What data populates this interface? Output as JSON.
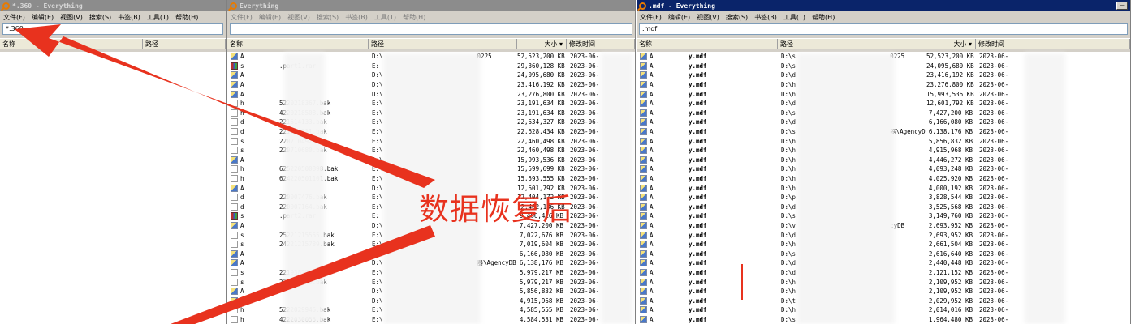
{
  "windows": [
    {
      "title": "*.360 - Everything",
      "menu": [
        "文件(F)",
        "编辑(E)",
        "视图(V)",
        "搜索(S)",
        "书签(B)",
        "工具(T)",
        "帮助(H)"
      ],
      "search": "*.360",
      "columns": [
        "名称",
        "路径"
      ]
    },
    {
      "title": "Everything",
      "menu": [
        "文件(F)",
        "编辑(E)",
        "视图(V)",
        "搜索(S)",
        "书签(B)",
        "工具(T)",
        "帮助(H)"
      ],
      "search": "",
      "columns": [
        "名称",
        "路径",
        "大小",
        "修改时间"
      ],
      "rows": [
        {
          "icon": "db",
          "pre": "A",
          "suf": "",
          "path": "D:\\",
          "path_end": "0225",
          "size": "52,523,200 KB",
          "date": "2023-06-"
        },
        {
          "icon": "rar",
          "pre": "s",
          "suf": ".part1.rar",
          "path": "E:",
          "path_end": "",
          "size": "29,360,128 KB",
          "date": "2023-06-"
        },
        {
          "icon": "db",
          "pre": "A",
          "suf": "",
          "path": "D:\\",
          "path_end": "",
          "size": "24,095,680 KB",
          "date": "2023-06-"
        },
        {
          "icon": "db",
          "pre": "A",
          "suf": "",
          "path": "D:\\",
          "path_end": "",
          "size": "23,416,192 KB",
          "date": "2023-06-"
        },
        {
          "icon": "db",
          "pre": "A",
          "suf": "",
          "path": "D:\\",
          "path_end": "",
          "size": "23,276,800 KB",
          "date": "2023-06-"
        },
        {
          "icon": "doc",
          "pre": "h",
          "suf": "5220218367.bak",
          "path": "E:\\",
          "path_end": "",
          "size": "23,191,634 KB",
          "date": "2023-06-"
        },
        {
          "icon": "doc",
          "pre": "h",
          "suf": "4220218508.bak",
          "path": "E:\\",
          "path_end": "",
          "size": "23,191,634 KB",
          "date": "2023-06-"
        },
        {
          "icon": "doc",
          "pre": "d",
          "suf": "221514133.bak",
          "path": "E:\\",
          "path_end": "",
          "size": "22,634,327 KB",
          "date": "2023-06-"
        },
        {
          "icon": "doc",
          "pre": "d",
          "suf": "221514211.bak",
          "path": "E:\\",
          "path_end": "",
          "size": "22,628,434 KB",
          "date": "2023-06-"
        },
        {
          "icon": "doc",
          "pre": "s",
          "suf": "220710492.bak",
          "path": "E:\\",
          "path_end": "",
          "size": "22,460,498 KB",
          "date": "2023-06-"
        },
        {
          "icon": "doc",
          "pre": "s",
          "suf": "220710680.bak",
          "path": "E:\\",
          "path_end": "",
          "size": "22,460,498 KB",
          "date": "2023-06-"
        },
        {
          "icon": "db",
          "pre": "A",
          "suf": "",
          "path": "D:\\",
          "path_end": "",
          "size": "15,993,536 KB",
          "date": "2023-06-"
        },
        {
          "icon": "doc",
          "pre": "h",
          "suf": "625220500898.bak",
          "path": "E:\\",
          "path_end": "",
          "size": "15,599,699 KB",
          "date": "2023-06-"
        },
        {
          "icon": "doc",
          "pre": "h",
          "suf": "624220501101.bak",
          "path": "E:\\",
          "path_end": "",
          "size": "15,593,555 KB",
          "date": "2023-06-"
        },
        {
          "icon": "db",
          "pre": "A",
          "suf": "",
          "path": "D:\\",
          "path_end": "",
          "size": "12,601,792 KB",
          "date": "2023-06-"
        },
        {
          "icon": "doc",
          "pre": "d",
          "suf": "220007476.bak",
          "path": "E:\\",
          "path_end": "",
          "size": "12,404,172 KB",
          "date": "2023-06-"
        },
        {
          "icon": "doc",
          "pre": "d",
          "suf": "220007164.bak",
          "path": "E:\\",
          "path_end": "",
          "size": "12,402,136 KB",
          "date": "2023-06-"
        },
        {
          "icon": "rar",
          "pre": "s",
          "suf": ".part2.rar",
          "path": "E:",
          "path_end": "",
          "size": "9,466,416 KB",
          "date": "2023-06-"
        },
        {
          "icon": "db",
          "pre": "A",
          "suf": "",
          "path": "D:\\",
          "path_end": "",
          "size": "7,427,200 KB",
          "date": "2023-06-"
        },
        {
          "icon": "doc",
          "pre": "s",
          "suf": "25221215555.bak",
          "path": "E:\\",
          "path_end": "",
          "size": "7,022,676 KB",
          "date": "2023-06-"
        },
        {
          "icon": "doc",
          "pre": "s",
          "suf": "24221215789.bak",
          "path": "E:\\",
          "path_end": "",
          "size": "7,019,604 KB",
          "date": "2023-06-"
        },
        {
          "icon": "db",
          "pre": "A",
          "suf": "",
          "path": "D:\\",
          "path_end": "",
          "size": "6,166,080 KB",
          "date": "2023-06-"
        },
        {
          "icon": "db",
          "pre": "A",
          "suf": "",
          "path": "D:\\",
          "path_end": "器\\AgencyDB",
          "size": "6,138,176 KB",
          "date": "2023-06-"
        },
        {
          "icon": "doc",
          "pre": "s",
          "suf": "221938273.bak",
          "path": "E:\\",
          "path_end": "",
          "size": "5,979,217 KB",
          "date": "2023-06-"
        },
        {
          "icon": "doc",
          "pre": "s",
          "suf": "221938920.bak",
          "path": "E:\\",
          "path_end": "",
          "size": "5,979,217 KB",
          "date": "2023-06-"
        },
        {
          "icon": "db",
          "pre": "A",
          "suf": "",
          "path": "D:\\",
          "path_end": "",
          "size": "5,856,832 KB",
          "date": "2023-06-"
        },
        {
          "icon": "db",
          "pre": "A",
          "suf": "",
          "path": "D:\\",
          "path_end": "",
          "size": "4,915,968 KB",
          "date": "2023-06-"
        },
        {
          "icon": "doc",
          "pre": "h",
          "suf": "5222029945.bak",
          "path": "E:\\",
          "path_end": "",
          "size": "4,585,555 KB",
          "date": "2023-06-"
        },
        {
          "icon": "doc",
          "pre": "h",
          "suf": "4222030055.bak",
          "path": "E:\\",
          "path_end": "",
          "size": "4,584,531 KB",
          "date": "2023-06-"
        }
      ]
    },
    {
      "title": ".mdf - Everything",
      "menu": [
        "文件(F)",
        "编辑(E)",
        "视图(V)",
        "搜索(S)",
        "书签(B)",
        "工具(T)",
        "帮助(H)"
      ],
      "search": ".mdf",
      "columns": [
        "名称",
        "路径",
        "大小",
        "修改时间"
      ],
      "rows": [
        {
          "pre": "A",
          "suf": "y.mdf",
          "path": "D:\\s",
          "path_end": "0225",
          "size": "52,523,200 KB",
          "date": "2023-06-"
        },
        {
          "pre": "A",
          "suf": "y.mdf",
          "path": "D:\\s",
          "path_end": "",
          "size": "24,095,680 KB",
          "date": "2023-06-"
        },
        {
          "pre": "A",
          "suf": "y.mdf",
          "path": "D:\\d",
          "path_end": "",
          "size": "23,416,192 KB",
          "date": "2023-06-"
        },
        {
          "pre": "A",
          "suf": "y.mdf",
          "path": "D:\\h",
          "path_end": "",
          "size": "23,276,800 KB",
          "date": "2023-06-"
        },
        {
          "pre": "A",
          "suf": "y.mdf",
          "path": "D:\\h",
          "path_end": "",
          "size": "15,993,536 KB",
          "date": "2023-06-"
        },
        {
          "pre": "A",
          "suf": "y.mdf",
          "path": "D:\\d",
          "path_end": "",
          "size": "12,601,792 KB",
          "date": "2023-06-"
        },
        {
          "pre": "A",
          "suf": "y.mdf",
          "path": "D:\\s",
          "path_end": "",
          "size": "7,427,200 KB",
          "date": "2023-06-"
        },
        {
          "pre": "A",
          "suf": "y.mdf",
          "path": "D:\\d",
          "path_end": "",
          "size": "6,166,080 KB",
          "date": "2023-06-"
        },
        {
          "pre": "A",
          "suf": "y.mdf",
          "path": "D:\\s",
          "path_end": "器\\AgencyDB",
          "size": "6,138,176 KB",
          "date": "2023-06-"
        },
        {
          "pre": "A",
          "suf": "y.mdf",
          "path": "D:\\h",
          "path_end": "",
          "size": "5,856,832 KB",
          "date": "2023-06-"
        },
        {
          "pre": "A",
          "suf": "y.mdf",
          "path": "D:\\h",
          "path_end": "",
          "size": "4,915,968 KB",
          "date": "2023-06-"
        },
        {
          "pre": "A",
          "suf": "y.mdf",
          "path": "D:\\h",
          "path_end": "",
          "size": "4,446,272 KB",
          "date": "2023-06-"
        },
        {
          "pre": "A",
          "suf": "y.mdf",
          "path": "D:\\h",
          "path_end": "",
          "size": "4,093,248 KB",
          "date": "2023-06-"
        },
        {
          "pre": "A",
          "suf": "y.mdf",
          "path": "D:\\h",
          "path_end": "",
          "size": "4,025,920 KB",
          "date": "2023-06-"
        },
        {
          "pre": "A",
          "suf": "y.mdf",
          "path": "D:\\h",
          "path_end": "",
          "size": "4,000,192 KB",
          "date": "2023-06-"
        },
        {
          "pre": "A",
          "suf": "y.mdf",
          "path": "D:\\p",
          "path_end": "",
          "size": "3,828,544 KB",
          "date": "2023-06-"
        },
        {
          "pre": "A",
          "suf": "y.mdf",
          "path": "D:\\d",
          "path_end": "",
          "size": "3,525,568 KB",
          "date": "2023-06-"
        },
        {
          "pre": "A",
          "suf": "y.mdf",
          "path": "D:\\s",
          "path_end": "",
          "size": "3,149,760 KB",
          "date": "2023-06-"
        },
        {
          "pre": "A",
          "suf": "y.mdf",
          "path": "D:\\v",
          "path_end": "cyDB",
          "size": "2,693,952 KB",
          "date": "2023-06-"
        },
        {
          "pre": "A",
          "suf": "y.mdf",
          "path": "D:\\d",
          "path_end": "",
          "size": "2,693,952 KB",
          "date": "2023-06-"
        },
        {
          "pre": "A",
          "suf": "y.mdf",
          "path": "D:\\h",
          "path_end": "",
          "size": "2,661,504 KB",
          "date": "2023-06-"
        },
        {
          "pre": "A",
          "suf": "y.mdf",
          "path": "D:\\s",
          "path_end": "",
          "size": "2,616,640 KB",
          "date": "2023-06-"
        },
        {
          "pre": "A",
          "suf": "y.mdf",
          "path": "D:\\d",
          "path_end": "",
          "size": "2,440,448 KB",
          "date": "2023-06-"
        },
        {
          "pre": "A",
          "suf": "y.mdf",
          "path": "D:\\d",
          "path_end": "",
          "size": "2,121,152 KB",
          "date": "2023-06-"
        },
        {
          "pre": "A",
          "suf": "y.mdf",
          "path": "D:\\h",
          "path_end": "",
          "size": "2,109,952 KB",
          "date": "2023-06-"
        },
        {
          "pre": "A",
          "suf": "y.mdf",
          "path": "D:\\h",
          "path_end": "",
          "size": "2,109,952 KB",
          "date": "2023-06-"
        },
        {
          "pre": "A",
          "suf": "y.mdf",
          "path": "D:\\t",
          "path_end": "",
          "size": "2,029,952 KB",
          "date": "2023-06-"
        },
        {
          "pre": "A",
          "suf": "y.mdf",
          "path": "D:\\h",
          "path_end": "",
          "size": "2,014,016 KB",
          "date": "2023-06-"
        },
        {
          "pre": "A",
          "suf": "y.mdf",
          "path": "D:\\s",
          "path_end": "",
          "size": "1,964,480 KB",
          "date": "2023-06-"
        }
      ]
    }
  ],
  "overlay": {
    "text": "数据恢复后",
    "color": "#e8321e"
  }
}
